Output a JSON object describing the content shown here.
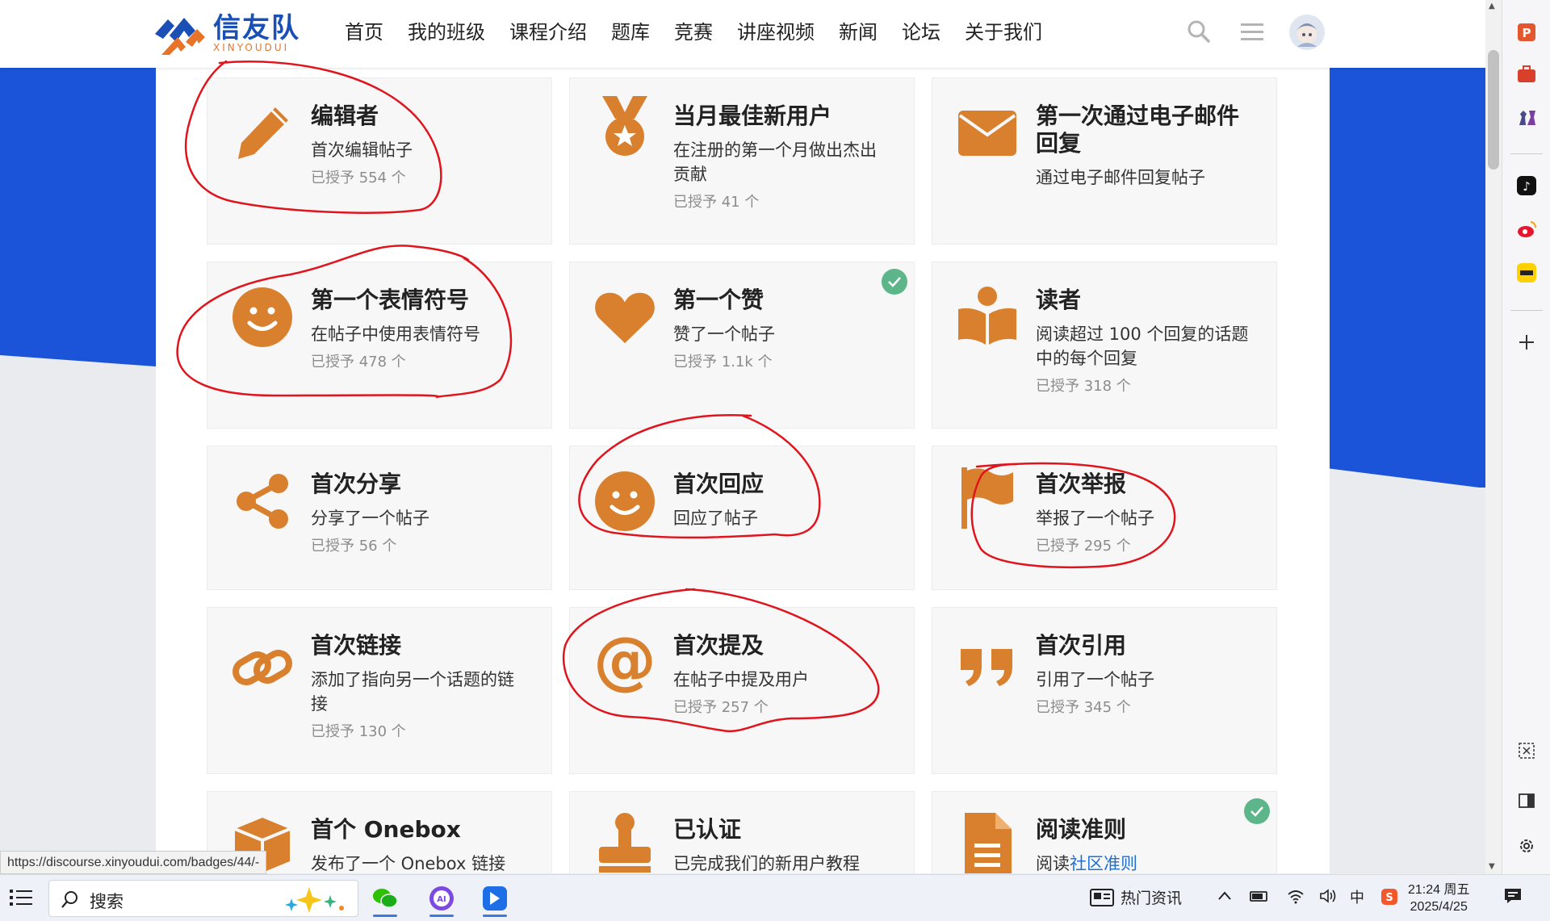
{
  "site": {
    "logo_main": "信友队",
    "logo_sub": "XINYOUDUI",
    "nav": [
      "首页",
      "我的班级",
      "课程介绍",
      "题库",
      "竞赛",
      "讲座视频",
      "新闻",
      "论坛",
      "关于我们"
    ]
  },
  "badges": [
    {
      "icon": "pencil-icon",
      "title": "编辑者",
      "desc": "首次编辑帖子",
      "count": "已授予 554 个"
    },
    {
      "icon": "medal-icon",
      "title": "当月最佳新用户",
      "desc": "在注册的第一个月做出杰出贡献",
      "count": "已授予 41 个"
    },
    {
      "icon": "envelope-icon",
      "title": "第一次通过电子邮件回复",
      "desc": "通过电子邮件回复帖子",
      "count": ""
    },
    {
      "icon": "smile-icon",
      "title": "第一个表情符号",
      "desc": "在帖子中使用表情符号",
      "count": "已授予 478 个"
    },
    {
      "icon": "heart-icon",
      "title": "第一个赞",
      "desc": "赞了一个帖子",
      "count": "已授予 1.1k 个",
      "earned": true
    },
    {
      "icon": "book-reader-icon",
      "title": "读者",
      "desc": "阅读超过 100 个回复的话题中的每个回复",
      "count": "已授予 318 个"
    },
    {
      "icon": "share-icon",
      "title": "首次分享",
      "desc": "分享了一个帖子",
      "count": "已授予 56 个"
    },
    {
      "icon": "smile-icon",
      "title": "首次回应",
      "desc": "回应了帖子",
      "count": ""
    },
    {
      "icon": "flag-icon",
      "title": "首次举报",
      "desc": "举报了一个帖子",
      "count": "已授予 295 个"
    },
    {
      "icon": "link-icon",
      "title": "首次链接",
      "desc": "添加了指向另一个话题的链接",
      "count": "已授予 130 个"
    },
    {
      "icon": "at-icon",
      "title": "首次提及",
      "desc": "在帖子中提及用户",
      "count": "已授予 257 个"
    },
    {
      "icon": "quote-icon",
      "title": "首次引用",
      "desc": "引用了一个帖子",
      "count": "已授予 345 个"
    },
    {
      "icon": "box-icon",
      "title": "首个 Onebox",
      "desc": "发布了一个 Onebox 链接",
      "count": ""
    },
    {
      "icon": "stamp-icon",
      "title": "已认证",
      "desc": "已完成我们的新用户教程",
      "count": ""
    },
    {
      "icon": "document-icon",
      "title": "阅读准则",
      "desc_prefix": "阅读",
      "desc_link": "社区准则",
      "count": "",
      "earned": true
    }
  ],
  "status_url": "https://discourse.xinyoudui.com/badges/44/-",
  "taskbar": {
    "search_label": "搜索",
    "news_label": "热门资讯",
    "ime_label": "中",
    "time": "21:24 周五",
    "date": "2025/4/25"
  },
  "colors": {
    "icon": "#d9802e",
    "brand_blue": "#1b54d8",
    "annotation": "#e0141c",
    "earned_check": "#5cb68a"
  }
}
